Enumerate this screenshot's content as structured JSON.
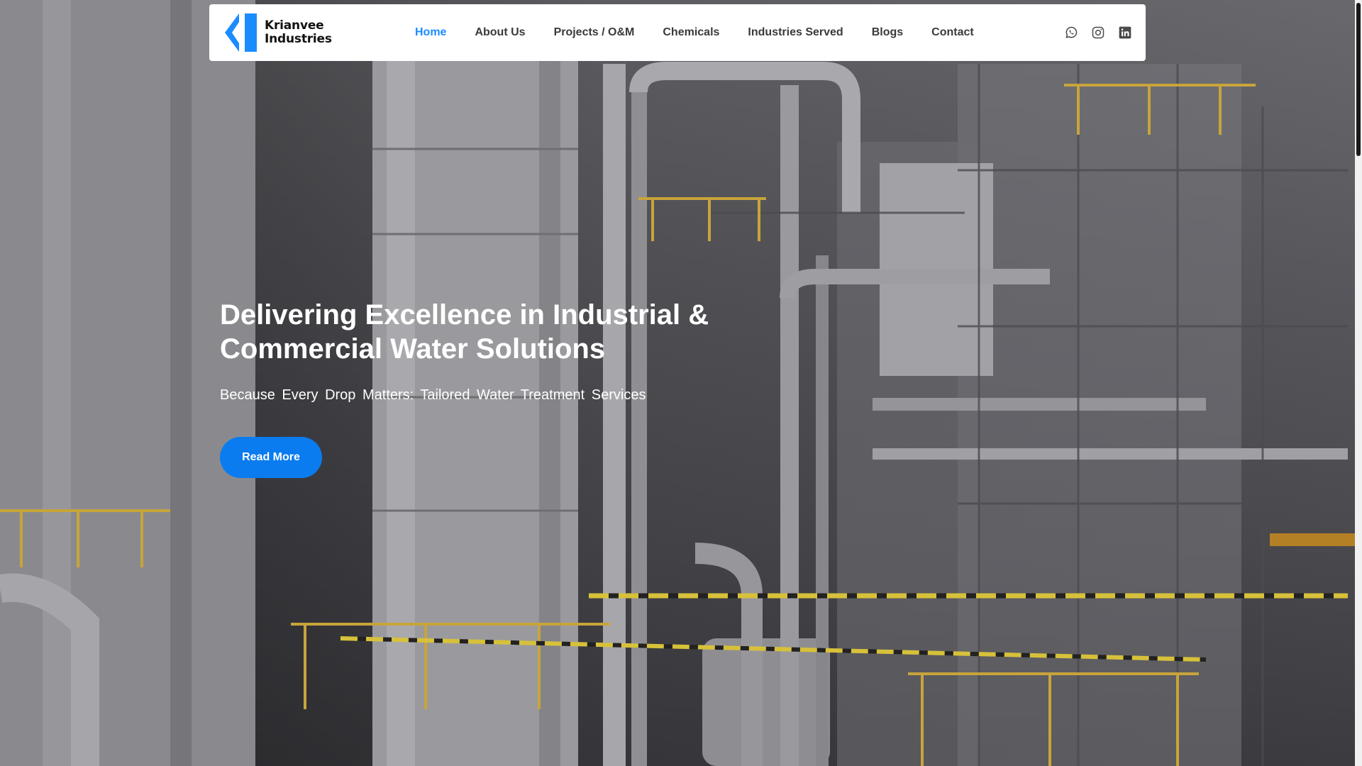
{
  "brand": {
    "name_line1": "Krianvee",
    "name_line2": "Industries",
    "accent_color": "#1a8cff"
  },
  "nav": {
    "items": [
      {
        "label": "Home",
        "active": true
      },
      {
        "label": "About Us"
      },
      {
        "label": "Projects / O&M"
      },
      {
        "label": "Chemicals"
      },
      {
        "label": "Industries Served"
      },
      {
        "label": "Blogs"
      },
      {
        "label": "Contact"
      }
    ]
  },
  "socials": [
    {
      "icon": "whatsapp-icon"
    },
    {
      "icon": "instagram-icon"
    },
    {
      "icon": "linkedin-icon"
    }
  ],
  "hero": {
    "title": "Delivering Excellence in Industrial & Commercial Water Solutions",
    "subtitle": "Because Every Drop Matters: Tailored Water Treatment Services",
    "cta_label": "Read More",
    "cta_color": "#0a7cf0"
  }
}
